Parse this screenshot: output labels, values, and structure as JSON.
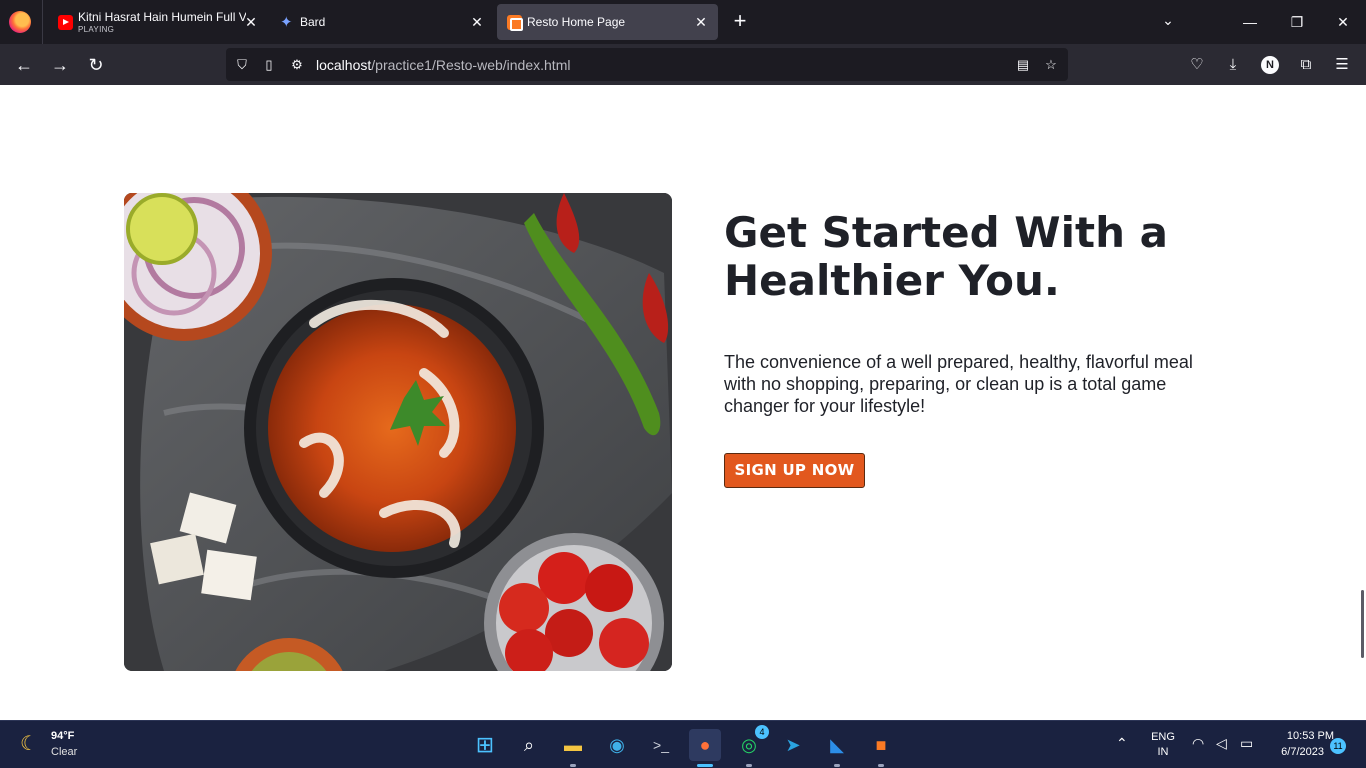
{
  "browser": {
    "tabs": [
      {
        "title": "Kitni Hasrat Hain Humein Full V",
        "subtitle": "PLAYING",
        "icon": "youtube-icon",
        "active": false
      },
      {
        "title": "Bard",
        "icon": "bard-sparkle-icon",
        "active": false
      },
      {
        "title": "Resto Home Page",
        "icon": "xampp-icon",
        "active": true
      }
    ],
    "url_host": "localhost",
    "url_path": "/practice1/Resto-web/index.html"
  },
  "hero": {
    "image": "butter chicken dish with onions, lemon, chilies, paneer and tomatoes",
    "headline": "Get Started With a Healthier You.",
    "description": "The convenience of a well prepared, healthy, flavorful meal with no shopping, preparing, or clean up is a total game changer for your lifestyle!",
    "cta_label": "SIGN UP NOW",
    "cta_color": "#e2581e"
  },
  "taskbar": {
    "weather_temp": "94°F",
    "weather_condition": "Clear",
    "whatsapp_badge": "4",
    "language_line1": "ENG",
    "language_line2": "IN",
    "time": "10:53 PM",
    "date": "6/7/2023",
    "notifications": "11"
  }
}
